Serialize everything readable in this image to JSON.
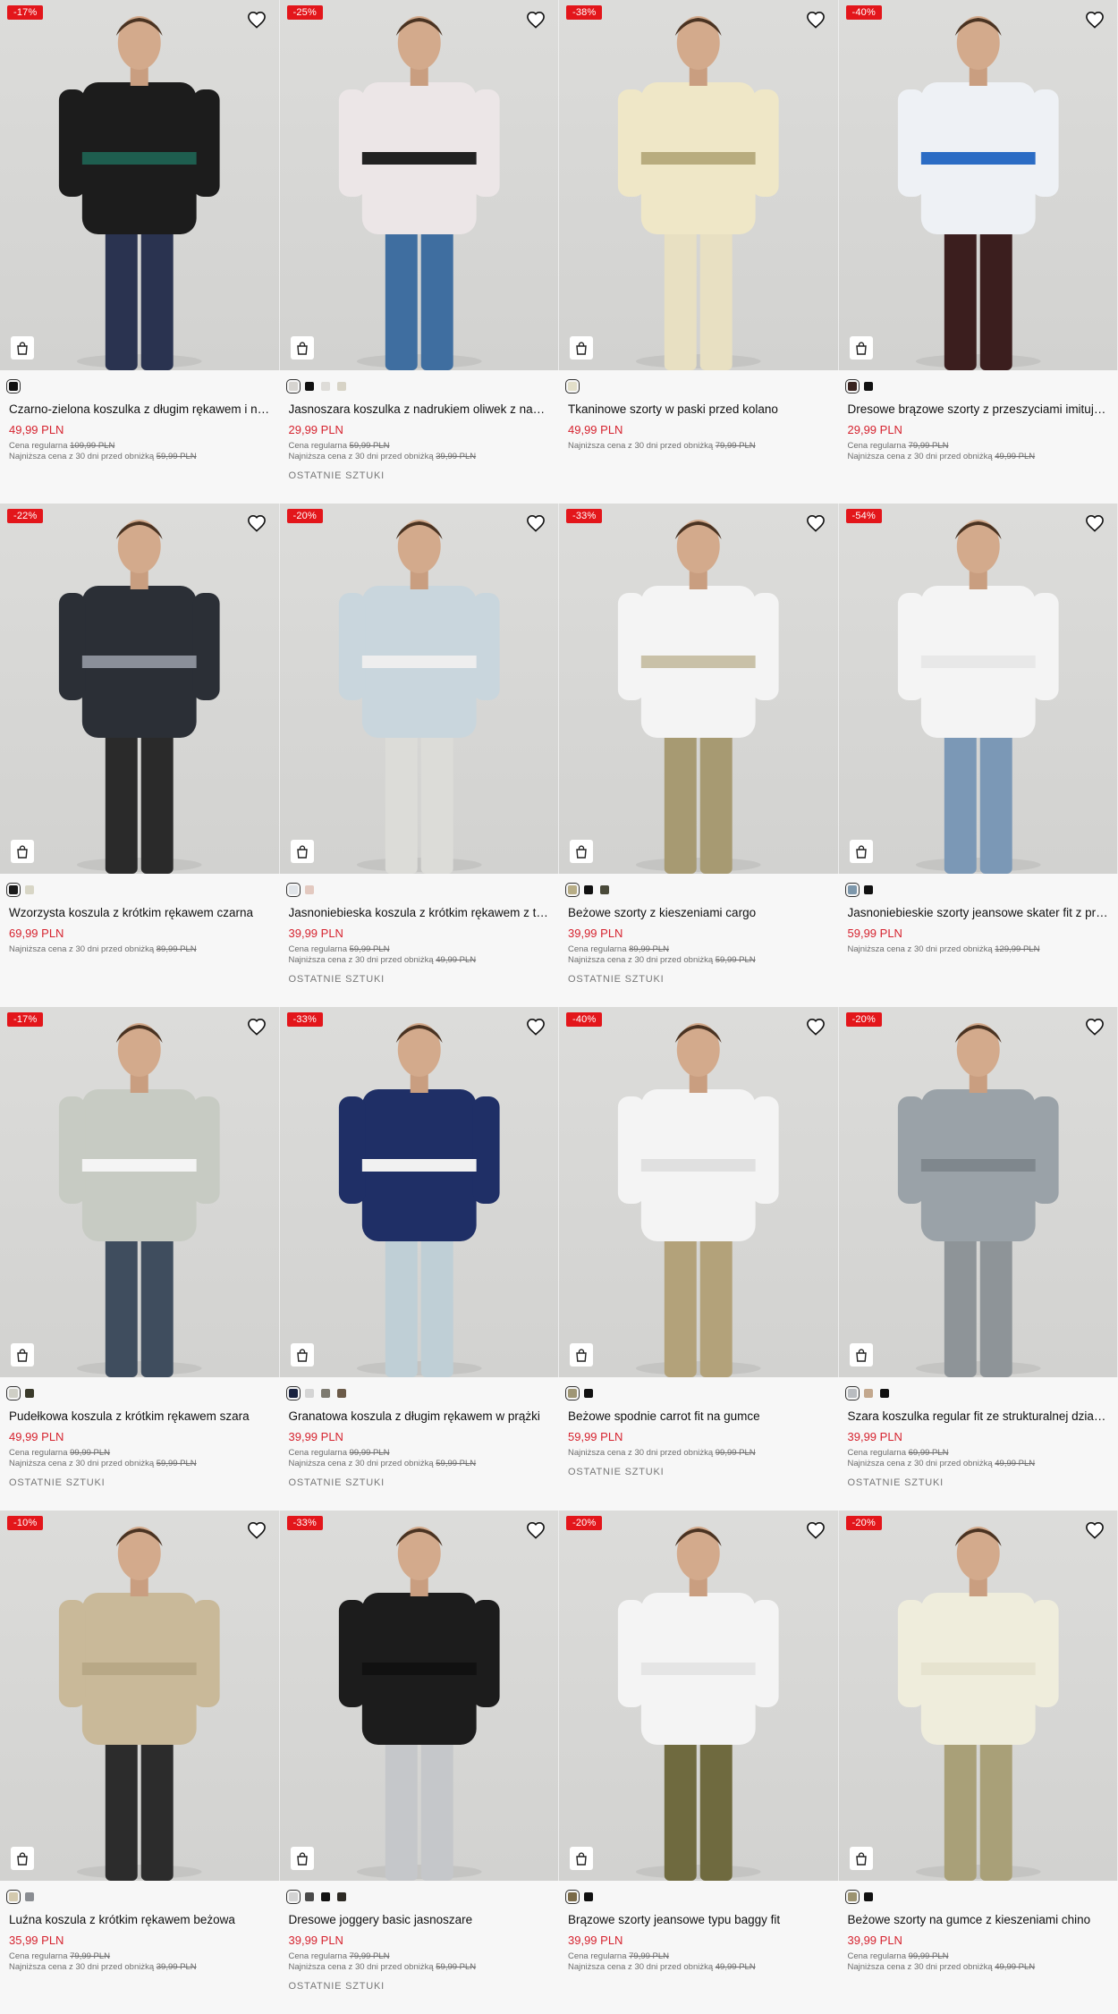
{
  "products": [
    {
      "discount": "-17%",
      "name": "Czarno-zielona koszulka z długim rękawem i nadrukiem",
      "price": "49,99 PLN",
      "regular_label": "Cena regularna",
      "regular_price": "109,99 PLN",
      "lowest_label": "Najniższa cena z 30 dni przed obniżką",
      "lowest_price": "59,99 PLN",
      "stock": "",
      "swatches": [
        "#111111"
      ],
      "palette": {
        "top": "#1c1c1c",
        "bottom": "#2a3350",
        "accent": "#1e5e4f"
      }
    },
    {
      "discount": "-25%",
      "name": "Jasnoszara koszulka z nadrukiem oliwek z napisem",
      "price": "29,99 PLN",
      "regular_label": "Cena regularna",
      "regular_price": "59,99 PLN",
      "lowest_label": "Najniższa cena z 30 dni przed obniżką",
      "lowest_price": "39,99 PLN",
      "stock": "OSTATNIE SZTUKI",
      "swatches": [
        "#d6d4d0",
        "#111111",
        "#dedcd8",
        "#d7d3c6"
      ],
      "palette": {
        "top": "#ece6e7",
        "bottom": "#3f6ea0",
        "accent": "#222222"
      }
    },
    {
      "discount": "-38%",
      "name": "Tkaninowe szorty w paski przed kolano",
      "price": "49,99 PLN",
      "regular_label": "",
      "regular_price": "",
      "lowest_label": "Najniższa cena z 30 dni przed obniżką",
      "lowest_price": "79,99 PLN",
      "stock": "",
      "swatches": [
        "#e2dfc9"
      ],
      "palette": {
        "top": "#efe7c7",
        "bottom": "#e8e0c2",
        "accent": "#b8ac7e"
      }
    },
    {
      "discount": "-40%",
      "name": "Dresowe brązowe szorty z przeszyciami imitującymi",
      "price": "29,99 PLN",
      "regular_label": "Cena regularna",
      "regular_price": "79,99 PLN",
      "lowest_label": "Najniższa cena z 30 dni przed obniżką",
      "lowest_price": "49,99 PLN",
      "stock": "",
      "swatches": [
        "#3a2420",
        "#111111"
      ],
      "palette": {
        "top": "#eef1f5",
        "bottom": "#3b1e1e",
        "accent": "#2b6cc4"
      }
    },
    {
      "discount": "-22%",
      "name": "Wzorzysta koszula z krótkim rękawem czarna",
      "price": "69,99 PLN",
      "regular_label": "",
      "regular_price": "",
      "lowest_label": "Najniższa cena z 30 dni przed obniżką",
      "lowest_price": "89,99 PLN",
      "stock": "",
      "swatches": [
        "#1a1a1a",
        "#d8d6c6"
      ],
      "palette": {
        "top": "#2b2f36",
        "bottom": "#2a2a2a",
        "accent": "#8a8f99"
      }
    },
    {
      "discount": "-20%",
      "name": "Jasnoniebieska koszula z krótkim rękawem z teksturą",
      "price": "39,99 PLN",
      "regular_label": "Cena regularna",
      "regular_price": "59,99 PLN",
      "lowest_label": "Najniższa cena z 30 dni przed obniżką",
      "lowest_price": "49,99 PLN",
      "stock": "OSTATNIE SZTUKI",
      "swatches": [
        "#e0e4e8",
        "#e3c9c0"
      ],
      "palette": {
        "top": "#c9d6dd",
        "bottom": "#dcdcd8",
        "accent": "#eeeeee"
      }
    },
    {
      "discount": "-33%",
      "name": "Beżowe szorty z kieszeniami cargo",
      "price": "39,99 PLN",
      "regular_label": "Cena regularna",
      "regular_price": "89,99 PLN",
      "lowest_label": "Najniższa cena z 30 dni przed obniżką",
      "lowest_price": "59,99 PLN",
      "stock": "OSTATNIE SZTUKI",
      "swatches": [
        "#b7ad86",
        "#111111",
        "#4a4a3a"
      ],
      "palette": {
        "top": "#f4f4f4",
        "bottom": "#a79a72",
        "accent": "#c9c1a8"
      }
    },
    {
      "discount": "-54%",
      "name": "Jasnoniebieskie szorty jeansowe skater fit z przetarciami",
      "price": "59,99 PLN",
      "regular_label": "",
      "regular_price": "",
      "lowest_label": "Najniższa cena z 30 dni przed obniżką",
      "lowest_price": "129,99 PLN",
      "stock": "",
      "swatches": [
        "#7d97ab",
        "#111111"
      ],
      "palette": {
        "top": "#f4f4f4",
        "bottom": "#7b98b6",
        "accent": "#e8e8e8"
      }
    },
    {
      "discount": "-17%",
      "name": "Pudełkowa koszula z krótkim rękawem szara",
      "price": "49,99 PLN",
      "regular_label": "Cena regularna",
      "regular_price": "99,99 PLN",
      "lowest_label": "Najniższa cena z 30 dni przed obniżką",
      "lowest_price": "59,99 PLN",
      "stock": "OSTATNIE SZTUKI",
      "swatches": [
        "#cfcfc6",
        "#3a3a2a"
      ],
      "palette": {
        "top": "#c7cbc3",
        "bottom": "#3f4d5e",
        "accent": "#f4f4f4"
      }
    },
    {
      "discount": "-33%",
      "name": "Granatowa koszula z długim rękawem w prążki",
      "price": "39,99 PLN",
      "regular_label": "Cena regularna",
      "regular_price": "99,99 PLN",
      "lowest_label": "Najniższa cena z 30 dni przed obniżką",
      "lowest_price": "59,99 PLN",
      "stock": "OSTATNIE SZTUKI",
      "swatches": [
        "#1a2340",
        "#d5d5d5",
        "#7d7a70",
        "#6b5a48"
      ],
      "palette": {
        "top": "#1f2f66",
        "bottom": "#bfcfd6",
        "accent": "#f1f1f1"
      }
    },
    {
      "discount": "-40%",
      "name": "Beżowe spodnie carrot fit na gumce",
      "price": "59,99 PLN",
      "regular_label": "",
      "regular_price": "",
      "lowest_label": "Najniższa cena z 30 dni przed obniżką",
      "lowest_price": "99,99 PLN",
      "stock": "OSTATNIE SZTUKI",
      "swatches": [
        "#9f9675",
        "#111111"
      ],
      "palette": {
        "top": "#f4f4f4",
        "bottom": "#b3a27a",
        "accent": "#e0e0e0"
      }
    },
    {
      "discount": "-20%",
      "name": "Szara koszulka regular fit ze strukturalnej dzianiny",
      "price": "39,99 PLN",
      "regular_label": "Cena regularna",
      "regular_price": "69,99 PLN",
      "lowest_label": "Najniższa cena z 30 dni przed obniżką",
      "lowest_price": "49,99 PLN",
      "stock": "OSTATNIE SZTUKI",
      "swatches": [
        "#b9bcc0",
        "#c3a88e",
        "#111111"
      ],
      "palette": {
        "top": "#9aa2a8",
        "bottom": "#8e9498",
        "accent": "#7f878d"
      }
    },
    {
      "discount": "-10%",
      "name": "Luźna koszula z krótkim rękawem beżowa",
      "price": "35,99 PLN",
      "regular_label": "Cena regularna",
      "regular_price": "79,99 PLN",
      "lowest_label": "Najniższa cena z 30 dni przed obniżką",
      "lowest_price": "39,99 PLN",
      "stock": "",
      "swatches": [
        "#d3c9ae",
        "#8a8d92"
      ],
      "palette": {
        "top": "#c9b999",
        "bottom": "#2c2c2c",
        "accent": "#b8a886"
      }
    },
    {
      "discount": "-33%",
      "name": "Dresowe joggery basic jasnoszare",
      "price": "39,99 PLN",
      "regular_label": "Cena regularna",
      "regular_price": "79,99 PLN",
      "lowest_label": "Najniższa cena z 30 dni przed obniżką",
      "lowest_price": "59,99 PLN",
      "stock": "OSTATNIE SZTUKI",
      "swatches": [
        "#d3d3d3",
        "#4a4a4a",
        "#111111",
        "#2d2a24"
      ],
      "palette": {
        "top": "#1c1c1c",
        "bottom": "#c5c7ca",
        "accent": "#111111"
      }
    },
    {
      "discount": "-20%",
      "name": "Brązowe szorty jeansowe typu baggy fit",
      "price": "39,99 PLN",
      "regular_label": "Cena regularna",
      "regular_price": "79,99 PLN",
      "lowest_label": "Najniższa cena z 30 dni przed obniżką",
      "lowest_price": "49,99 PLN",
      "stock": "",
      "swatches": [
        "#7a6a48",
        "#111111"
      ],
      "palette": {
        "top": "#f4f4f4",
        "bottom": "#6f6a3f",
        "accent": "#e5e5e5"
      }
    },
    {
      "discount": "-20%",
      "name": "Beżowe szorty na gumce z kieszeniami chino",
      "price": "39,99 PLN",
      "regular_label": "Cena regularna",
      "regular_price": "99,99 PLN",
      "lowest_label": "Najniższa cena z 30 dni przed obniżką",
      "lowest_price": "49,99 PLN",
      "stock": "",
      "swatches": [
        "#9c9370",
        "#111111"
      ],
      "palette": {
        "top": "#efeddc",
        "bottom": "#a9a078",
        "accent": "#e6e3cf"
      }
    }
  ],
  "colors": {
    "accent": "#d6232f",
    "badge": "#e3161b"
  },
  "icons": {
    "favorite": "heart-outline-icon",
    "cart": "shopping-bag-icon"
  }
}
